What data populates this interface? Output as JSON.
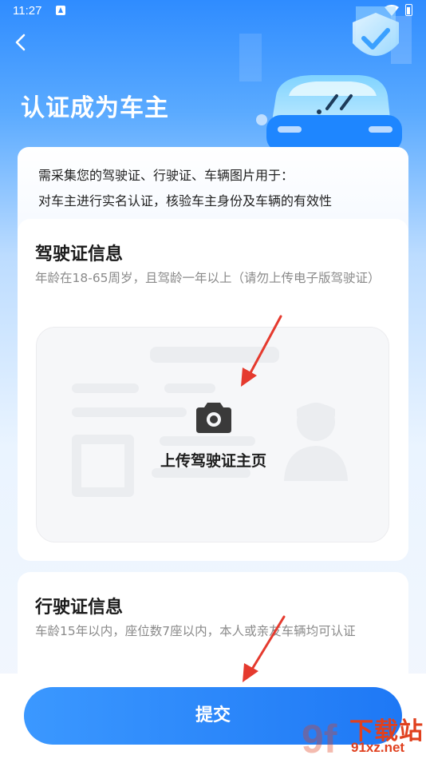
{
  "status_bar": {
    "time": "11:27"
  },
  "header": {
    "title": "认证成为车主"
  },
  "intro": {
    "line1": "需采集您的驾驶证、行驶证、车辆图片用于：",
    "line2": "对车主进行实名认证，核验车主身份及车辆的有效性"
  },
  "license_section": {
    "title": "驾驶证信息",
    "description": "年龄在18-65周岁，且驾龄一年以上（请勿上传电子版驾驶证）",
    "upload_label": "上传驾驶证主页"
  },
  "vehicle_section": {
    "title": "行驶证信息",
    "description": "车龄15年以内，座位数7座以内，本人或亲友车辆均可认证"
  },
  "submit": {
    "label": "提交"
  },
  "watermark": {
    "text": "下载站",
    "url": "91xz.net",
    "logo": "9f"
  },
  "colors": {
    "primary": "#2f8cff",
    "button": "#1e78f5",
    "annotation_arrow": "#e53a2e"
  },
  "icons": [
    "back-icon",
    "camera-icon",
    "wifi-icon",
    "battery-icon",
    "shield-check-icon"
  ]
}
